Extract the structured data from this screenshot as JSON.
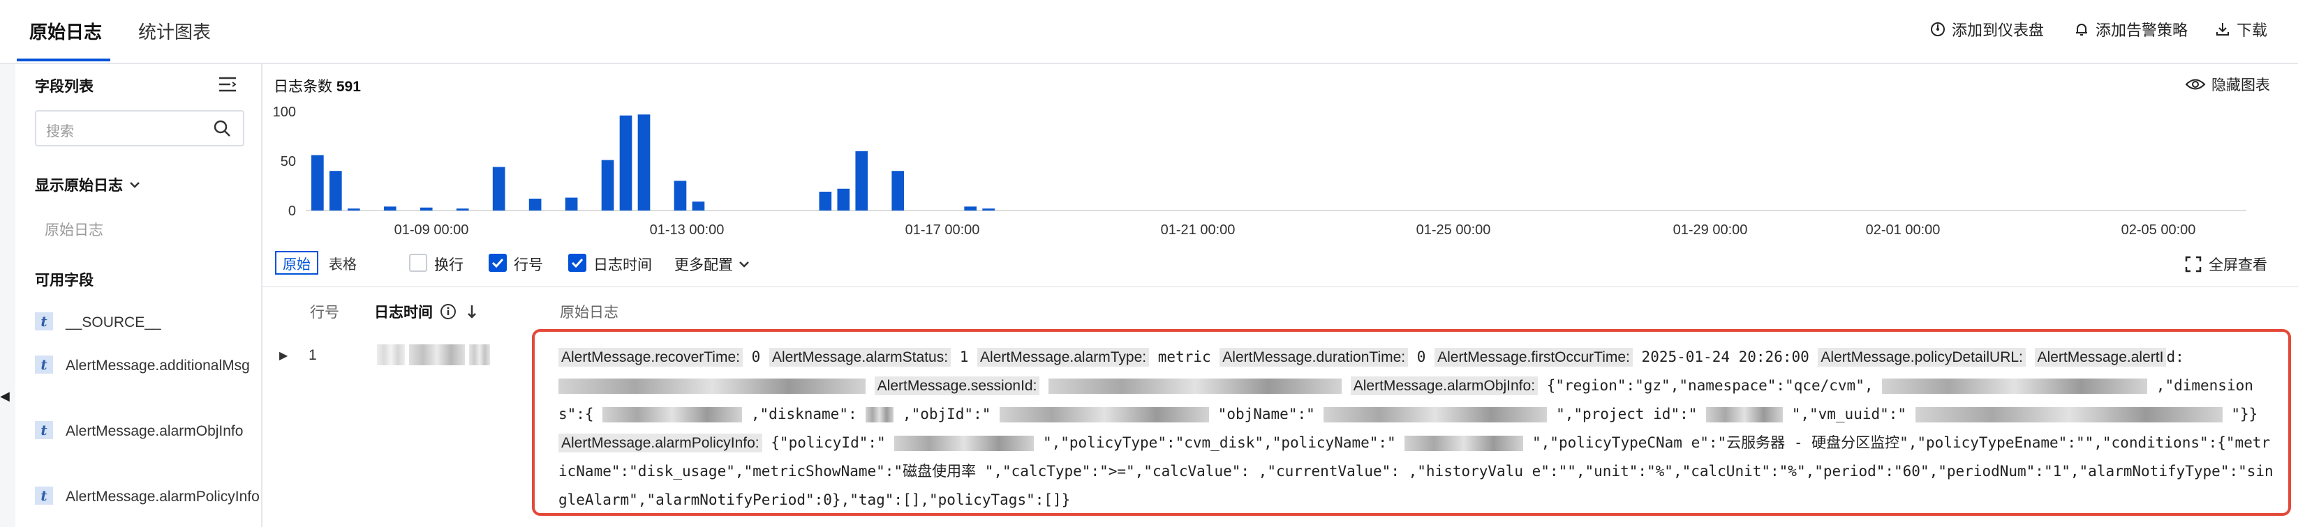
{
  "tabs": [
    {
      "label": "原始日志",
      "active": true
    },
    {
      "label": "统计图表",
      "active": false
    }
  ],
  "toolbar_right": {
    "add_dashboard": "添加到仪表盘",
    "add_alarm": "添加告警策略",
    "download": "下载"
  },
  "sidebar": {
    "field_list_title": "字段列表",
    "search_placeholder": "搜索",
    "show_raw_title": "显示原始日志",
    "raw_log_item": "原始日志",
    "available_title": "可用字段",
    "fields": [
      {
        "type": "t",
        "name": "__SOURCE__"
      },
      {
        "type": "t",
        "name": "AlertMessage.additionalMsg"
      },
      {
        "type": "t",
        "name": "AlertMessage.alarmObjInfo"
      },
      {
        "type": "t",
        "name": "AlertMessage.alarmPolicyInfo"
      }
    ]
  },
  "histogram": {
    "count_label": "日志条数",
    "count_value": "591",
    "hide_chart": "隐藏图表"
  },
  "chart_data": {
    "type": "bar",
    "ylim": [
      0,
      100
    ],
    "yticks": [
      "100",
      "50",
      "0"
    ],
    "xticks": [
      "01-09 00:00",
      "01-13 00:00",
      "01-17 00:00",
      "01-21 00:00",
      "01-25 00:00",
      "01-29 00:00",
      "02-01 00:00",
      "02-05 00:00"
    ],
    "values": [
      56,
      40,
      2,
      0,
      4,
      0,
      3,
      0,
      2,
      0,
      44,
      0,
      12,
      0,
      13,
      0,
      51,
      96,
      97,
      0,
      30,
      9,
      0,
      0,
      0,
      0,
      0,
      0,
      19,
      22,
      60,
      0,
      40,
      0,
      0,
      0,
      4,
      2
    ]
  },
  "log_toolbar": {
    "view_raw": "原始",
    "view_table": "表格",
    "wrap": "换行",
    "line_no": "行号",
    "log_time": "日志时间",
    "more_config": "更多配置",
    "fullscreen": "全屏查看"
  },
  "table": {
    "col_line": "行号",
    "col_time": "日志时间",
    "col_raw": "原始日志",
    "row": {
      "line_no": "1",
      "k_recoverTime": "AlertMessage.recoverTime:",
      "v_recoverTime": "0",
      "k_alarmStatus": "AlertMessage.alarmStatus:",
      "v_alarmStatus": "1",
      "k_alarmType": "AlertMessage.alarmType:",
      "v_alarmType": "metric",
      "k_durationTime": "AlertMessage.durationTime:",
      "v_durationTime": "0",
      "k_firstOccurTime": "AlertMessage.firstOccurTime:",
      "v_firstOccurTime": "2025-01-24 20:26:00",
      "k_policyDetailURL": "AlertMessage.policyDetailURL:",
      "k_alertId": "AlertMessage.alertI",
      "t_d": "d:",
      "k_sessionId": "AlertMessage.sessionId:",
      "k_alarmObjInfo": "AlertMessage.alarmObjInfo:",
      "v_objinfo_a": "{\"region\":\"gz\",\"namespace\":\"qce/cvm\",",
      "v_objinfo_b": ",\"dimensions\":{",
      "v_objinfo_c": ",\"diskname\":",
      "v_objinfo_d": ",\"objId\":\"",
      "v_objinfo_e": "\"objName\":\"",
      "v_objinfo_f": "\",\"project",
      "v_objinfo_g": "id\":\"",
      "v_objinfo_h": "\",\"vm_uuid\":\"",
      "v_objinfo_i": "\"}}",
      "k_alarmPolicyInfo": "AlertMessage.alarmPolicyInfo:",
      "v_policy_a": "{\"policyId\":\"",
      "v_policy_b": "\",\"policyType\":\"cvm_disk\",\"policyName\":\"",
      "v_policy_c": "\",\"policyTypeCNam",
      "v_policy_d": "e\":\"云服务器 - 硬盘分区监控\",\"policyTypeEname\":\"\",\"conditions\":{\"metricName\":\"disk_usage\",\"metricShowName\":\"磁盘使用率 \",\"calcType\":\">=\",\"calcValue\":",
      "v_policy_e": ",\"currentValue\":",
      "v_policy_f": ",\"historyValu",
      "v_policy_g": "e\":\"\",\"unit\":\"%\",\"calcUnit\":\"%\",\"period\":\"60\",\"periodNum\":\"1\",\"alarmNotifyType\":\"singleAlarm\",\"alarmNotifyPeriod\":0},\"tag\":[],\"policyTags\":[]}"
    }
  }
}
